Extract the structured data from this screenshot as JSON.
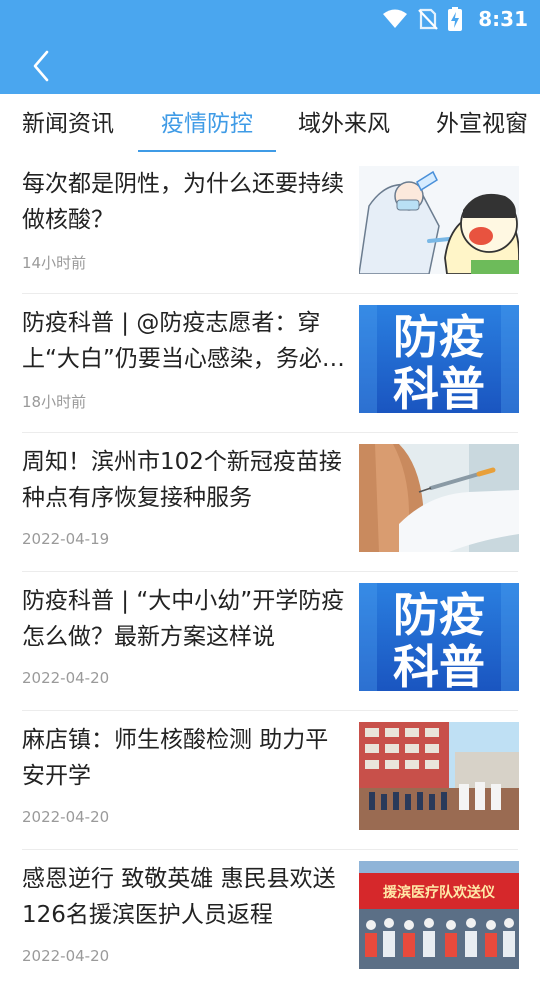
{
  "status_bar": {
    "time": "8:31"
  },
  "tabs": [
    {
      "label": "新闻资讯",
      "active": false
    },
    {
      "label": "疫情防控",
      "active": true
    },
    {
      "label": "域外来风",
      "active": false
    },
    {
      "label": "外宣视窗",
      "active": false
    }
  ],
  "feed": [
    {
      "title": "每次都是阴性，为什么还要持续做核酸？",
      "time": "14小时前",
      "thumb": "nucleic-test-illustration"
    },
    {
      "title": "防疫科普 | @防疫志愿者：穿上“大白”仍要当心感染，务必做好个人防护",
      "time": "18小时前",
      "thumb": "fangyi-kepu-banner",
      "thumb_text": [
        "防疫",
        "科普"
      ]
    },
    {
      "title": "周知！滨州市102个新冠疫苗接种点有序恢复接种服务",
      "time": "2022-04-19",
      "thumb": "vaccine-injection-photo"
    },
    {
      "title": "防疫科普 | “大中小幼”开学防疫怎么做？最新方案这样说",
      "time": "2022-04-20",
      "thumb": "fangyi-kepu-banner",
      "thumb_text": [
        "防疫",
        "科普"
      ]
    },
    {
      "title": "麻店镇：师生核酸检测 助力平安开学",
      "time": "2022-04-20",
      "thumb": "school-testing-photo"
    },
    {
      "title": "感恩逆行 致敬英雄  惠民县欢送126名援滨医护人员返程",
      "time": "2022-04-20",
      "thumb": "farewell-ceremony-photo",
      "thumb_text": [
        "援滨医疗队欢送仪"
      ]
    }
  ]
}
